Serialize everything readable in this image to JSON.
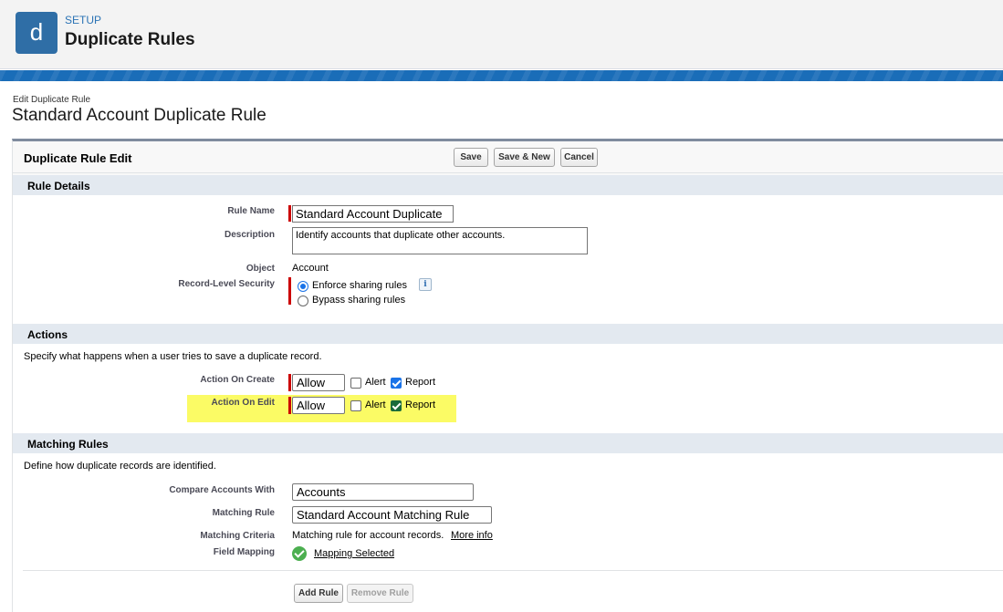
{
  "header": {
    "app_letter": "d",
    "setup_label": "SETUP",
    "title": "Duplicate Rules"
  },
  "page": {
    "subtitle": "Edit Duplicate Rule",
    "title": "Standard Account Duplicate Rule"
  },
  "panel": {
    "title": "Duplicate Rule Edit",
    "buttons": {
      "save": "Save",
      "save_new": "Save & New",
      "cancel": "Cancel"
    }
  },
  "rule_details": {
    "heading": "Rule Details",
    "rule_name_label": "Rule Name",
    "rule_name_value": "Standard Account Duplicate",
    "description_label": "Description",
    "description_value": "Identify accounts that duplicate other accounts.",
    "object_label": "Object",
    "object_value": "Account",
    "security_label": "Record-Level Security",
    "security_options": [
      "Enforce sharing rules",
      "Bypass sharing rules"
    ],
    "security_selected": "Enforce sharing rules",
    "info_icon_glyph": "i"
  },
  "actions": {
    "heading": "Actions",
    "note": "Specify what happens when a user tries to save a duplicate record.",
    "on_create": {
      "label": "Action On Create",
      "action": "Allow",
      "alert_label": "Alert",
      "alert": false,
      "report_label": "Report",
      "report": true
    },
    "on_edit": {
      "label": "Action On Edit",
      "action": "Allow",
      "alert_label": "Alert",
      "alert": false,
      "report_label": "Report",
      "report": true
    },
    "highlight_color": "#fafa4a"
  },
  "matching_rules": {
    "heading": "Matching Rules",
    "note": "Define how duplicate records are identified.",
    "compare_label": "Compare Accounts With",
    "compare_value": "Accounts",
    "rule_label": "Matching Rule",
    "rule_value": "Standard Account Matching Rule",
    "criteria_label": "Matching Criteria",
    "criteria_value": "Matching rule for account records.",
    "more_info_link": "More info",
    "mapping_label": "Field Mapping",
    "mapping_link": "Mapping Selected",
    "add_rule": "Add Rule",
    "remove_rule": "Remove Rule"
  },
  "colors": {
    "app_icon": "#2f6ea6",
    "band": "#1a6db8",
    "setup_link": "#2b73b5",
    "section_head": "#e3e9f0",
    "required": "#cc0000"
  }
}
